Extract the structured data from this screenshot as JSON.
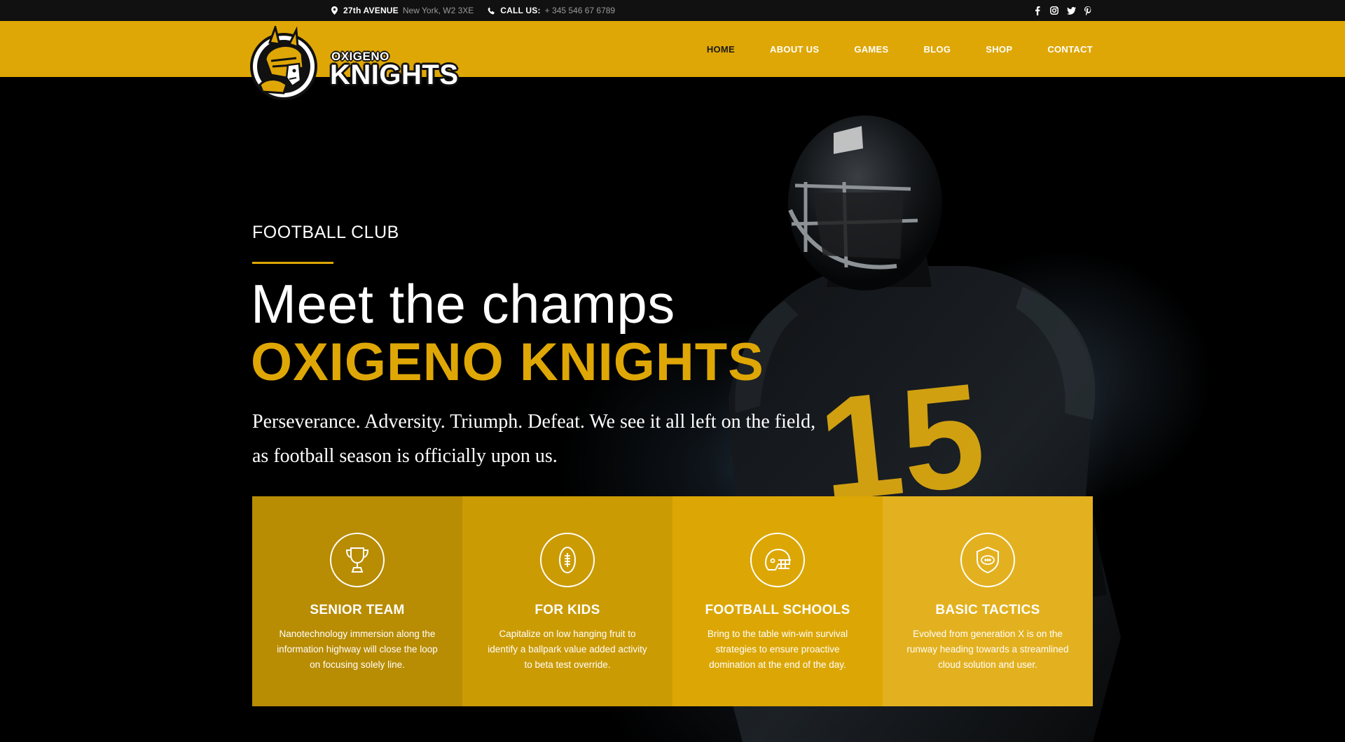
{
  "topbar": {
    "address_bold": "27th AVENUE",
    "address_rest": "New York, W2 3XE",
    "call_label": "CALL US:",
    "call_number": "+ 345 546 67 6789",
    "social": [
      "facebook-icon",
      "instagram-icon",
      "twitter-icon",
      "pinterest-icon"
    ]
  },
  "logo": {
    "top_text": "OXIGENO",
    "main_text": "KNIGHTS"
  },
  "nav": {
    "items": [
      {
        "label": "HOME",
        "active": true
      },
      {
        "label": "ABOUT US",
        "active": false
      },
      {
        "label": "GAMES",
        "active": false
      },
      {
        "label": "BLOG",
        "active": false
      },
      {
        "label": "SHOP",
        "active": false
      },
      {
        "label": "CONTACT",
        "active": false
      }
    ]
  },
  "hero": {
    "eyebrow": "FOOTBALL CLUB",
    "headline": "Meet the champs",
    "headline_accent": "OXIGENO KNIGHTS",
    "tagline_line1": "Perseverance. Adversity. Triumph. Defeat. We see it all left on the field,",
    "tagline_line2": "as football season is officially upon us.",
    "jersey_number": "15"
  },
  "cards": [
    {
      "icon": "trophy-icon",
      "title": "SENIOR TEAM",
      "desc": "Nanotechnology immersion along the information highway will close the loop on focusing solely line.",
      "color": "#b88c03"
    },
    {
      "icon": "football-icon",
      "title": "FOR KIDS",
      "desc": "Capitalize on low hanging fruit to identify a ballpark value added activity to beta test override.",
      "color": "#cb9b04"
    },
    {
      "icon": "helmet-icon",
      "title": "FOOTBALL SCHOOLS",
      "desc": "Bring to the table win-win survival strategies to ensure proactive domination at the end of the day.",
      "color": "#dca705"
    },
    {
      "icon": "shield-icon",
      "title": "BASIC TACTICS",
      "desc": "Evolved from generation X is on the runway heading towards a streamlined cloud solution and user.",
      "color": "#e3b11f"
    }
  ],
  "colors": {
    "accent": "#dfa705",
    "topbar": "#111111",
    "background": "#000000"
  }
}
